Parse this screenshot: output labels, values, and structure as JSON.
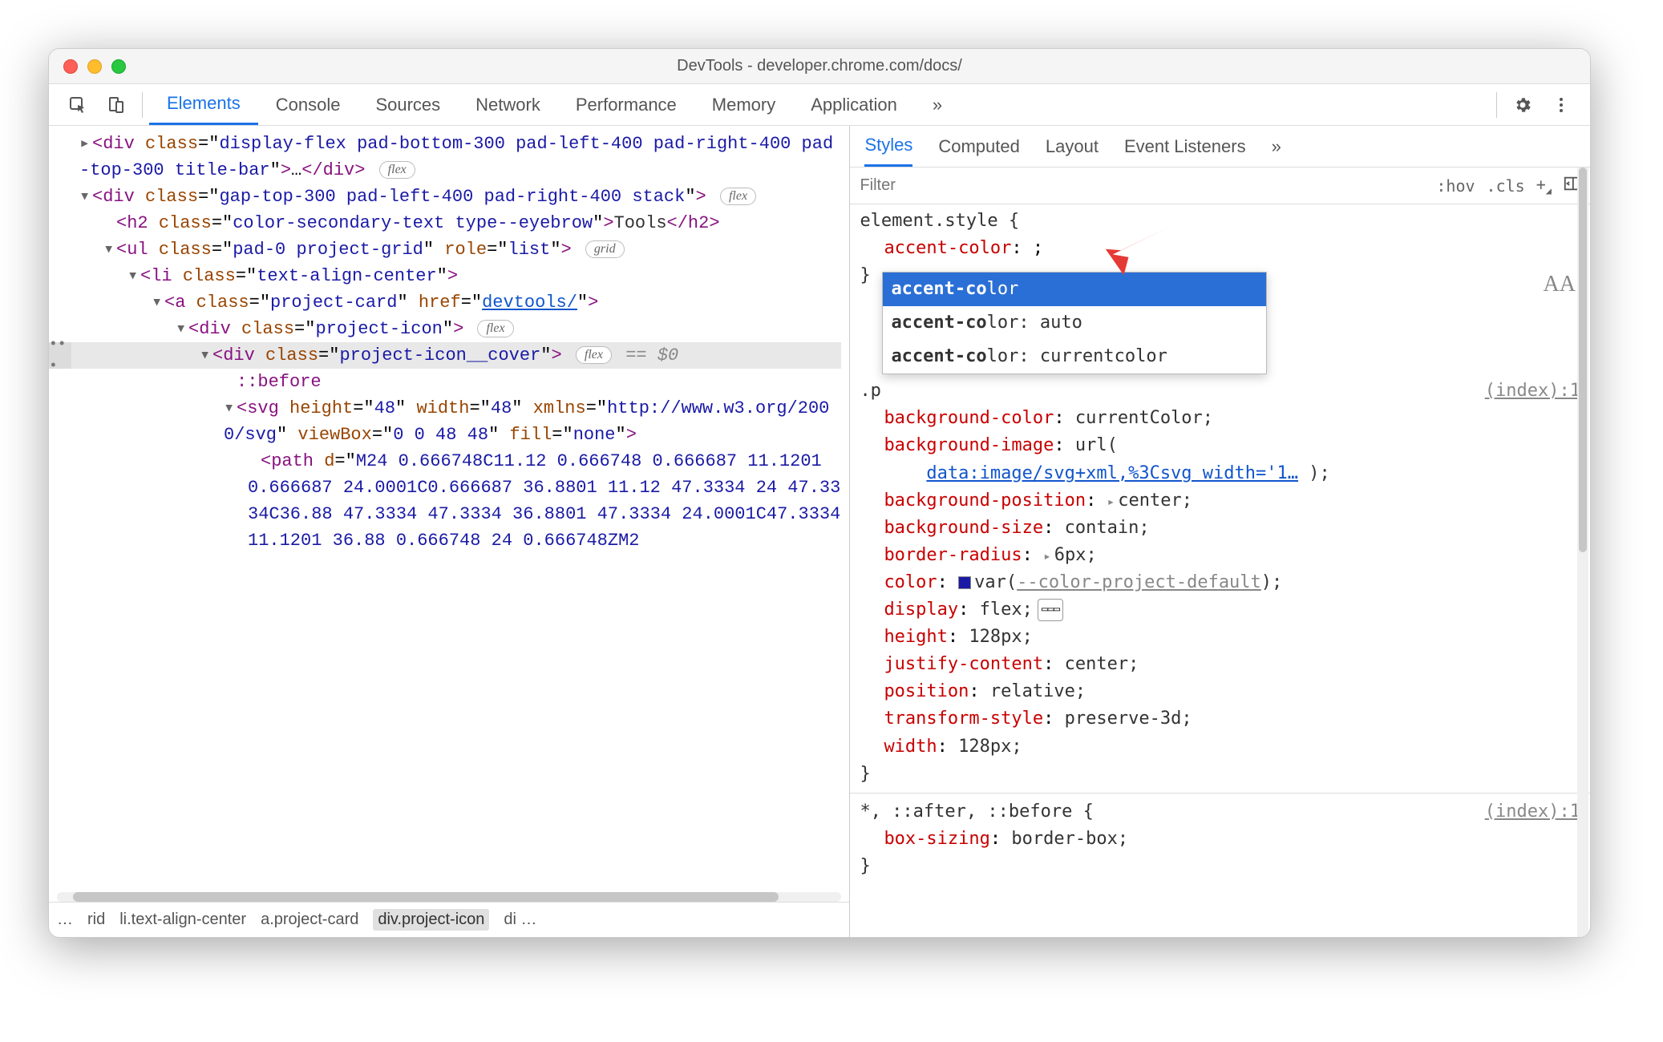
{
  "window": {
    "title": "DevTools - developer.chrome.com/docs/"
  },
  "maintabs": {
    "items": [
      "Elements",
      "Console",
      "Sources",
      "Network",
      "Performance",
      "Memory",
      "Application"
    ],
    "active": 0,
    "overflow": "»"
  },
  "dom": {
    "lines": [
      {
        "indent": 0,
        "arrow": "▸",
        "html": "<span class='p'>&lt;div</span> <span class='an'>class</span>=\"<span class='av'>display-flex pad-bottom-300 pad-left-400 pad-right-400 pad-top-300 title-bar</span>\"<span class='p'>&gt;</span>…<span class='p'>&lt;/div&gt;</span> <span class='pill'>flex</span>"
      },
      {
        "indent": 0,
        "arrow": "▾",
        "html": "<span class='p'>&lt;div</span> <span class='an'>class</span>=\"<span class='av'>gap-top-300 pad-left-400 pad-right-400 stack</span>\"<span class='p'>&gt;</span> <span class='pill'>flex</span>"
      },
      {
        "indent": 1,
        "arrow": "",
        "html": "<span class='p'>&lt;h2</span> <span class='an'>class</span>=\"<span class='av'>color-secondary-text type--eyebrow</span>\"<span class='p'>&gt;</span><span class='txt'>Tools</span><span class='p'>&lt;/h2&gt;</span>"
      },
      {
        "indent": 1,
        "arrow": "▾",
        "html": "<span class='p'>&lt;ul</span> <span class='an'>class</span>=\"<span class='av'>pad-0 project-grid</span>\" <span class='an'>role</span>=\"<span class='av'>list</span>\"<span class='p'>&gt;</span> <span class='pill'>grid</span>"
      },
      {
        "indent": 2,
        "arrow": "▾",
        "html": "<span class='p'>&lt;li</span> <span class='an'>class</span>=\"<span class='av'>text-align-center</span>\"<span class='p'>&gt;</span>"
      },
      {
        "indent": 3,
        "arrow": "▾",
        "html": "<span class='p'>&lt;a</span> <span class='an'>class</span>=\"<span class='av'>project-card</span>\" <span class='an'>href</span>=\"<span class='lnk'>devtools/</span>\"<span class='p'>&gt;</span>"
      },
      {
        "indent": 4,
        "arrow": "▾",
        "html": "<span class='p'>&lt;div</span> <span class='an'>class</span>=\"<span class='av'>project-icon</span>\"<span class='p'>&gt;</span> <span class='pill'>flex</span>"
      },
      {
        "indent": 5,
        "arrow": "▾",
        "sel": true,
        "html": "<span class='p'>&lt;div</span> <span class='an'>class</span>=\"<span class='av'>project-icon__cover</span>\"<span class='p'>&gt;</span> <span class='pill'>flex</span> <span class='dim'>== $0</span>"
      },
      {
        "indent": 6,
        "arrow": "",
        "html": "<span class='p'>::before</span>"
      },
      {
        "indent": 6,
        "arrow": "▾",
        "html": "<span class='p'>&lt;svg</span> <span class='an'>height</span>=\"<span class='av'>48</span>\" <span class='an'>width</span>=\"<span class='av'>48</span>\" <span class='an'>xmlns</span>=\"<span class='av'>http://www.w3.org/2000/svg</span>\" <span class='an'>viewBox</span>=\"<span class='av'>0 0 48 48</span>\" <span class='an'>fill</span>=\"<span class='av'>none</span>\"<span class='p'>&gt;</span>"
      },
      {
        "indent": 7,
        "arrow": "",
        "html": "<span class='p'>&lt;path</span> <span class='an'>d</span>=\"<span class='av'>M24 0.666748C11.12 0.666748 0.666687 11.1201 0.666687 24.0001C0.666687 36.8801 11.12 47.3334 24 47.3334C36.88 47.3334 47.3334 36.8801 47.3334 24.0001C47.3334 11.1201 36.88 0.666748 24 0.666748ZM2</span>"
      }
    ],
    "gutter_label": "•••",
    "scroll": {
      "left_pct": 2,
      "width_pct": 90
    }
  },
  "crumbs": {
    "prefix": "…",
    "items": [
      "rid",
      "li.text-align-center",
      "a.project-card",
      "div.project-icon",
      "di …"
    ],
    "selected": 3
  },
  "subtabs": {
    "items": [
      "Styles",
      "Computed",
      "Layout",
      "Event Listeners"
    ],
    "active": 0,
    "overflow": "»"
  },
  "filterbar": {
    "placeholder": "Filter",
    "hov": ":hov",
    "cls": ".cls",
    "plus": "+"
  },
  "styles": {
    "element_selector": "element.style {",
    "new_prop": "accent-color",
    "new_sep": ": ;",
    "close": "}",
    "autocomplete": [
      {
        "bold": "accent-co",
        "rest": "lor",
        "tail": ""
      },
      {
        "bold": "accent-co",
        "rest": "lor",
        "tail": ": auto"
      },
      {
        "bold": "accent-co",
        "rest": "lor",
        "tail": ": currentcolor"
      }
    ],
    "rule2": {
      "selector_prefix": ".p",
      "source": "(index):1",
      "props": [
        {
          "n": "background-color",
          "v": "currentColor;"
        },
        {
          "n": "background-image",
          "v": "url(",
          "link": "data:image/svg+xml,%3Csvg width='1…",
          "tail": " );"
        },
        {
          "n": "background-position",
          "v": "center;",
          "arrow": true
        },
        {
          "n": "background-size",
          "v": "contain;"
        },
        {
          "n": "border-radius",
          "v": "6px;",
          "arrow": true
        },
        {
          "n": "color",
          "v": "var(",
          "swatch": true,
          "varname": "--color-project-default",
          "tail": ");"
        },
        {
          "n": "display",
          "v": "flex;",
          "flexicon": true
        },
        {
          "n": "height",
          "v": "128px;"
        },
        {
          "n": "justify-content",
          "v": "center;"
        },
        {
          "n": "position",
          "v": "relative;"
        },
        {
          "n": "transform-style",
          "v": "preserve-3d;"
        },
        {
          "n": "width",
          "v": "128px;"
        }
      ]
    },
    "rule3": {
      "selector": "*, ::after, ::before {",
      "source": "(index):1",
      "props": [
        {
          "n": "box-sizing",
          "v": "border-box;"
        }
      ]
    },
    "scroll": {
      "top_pct": 0,
      "height_pct": 50
    }
  },
  "font_label": "AA"
}
